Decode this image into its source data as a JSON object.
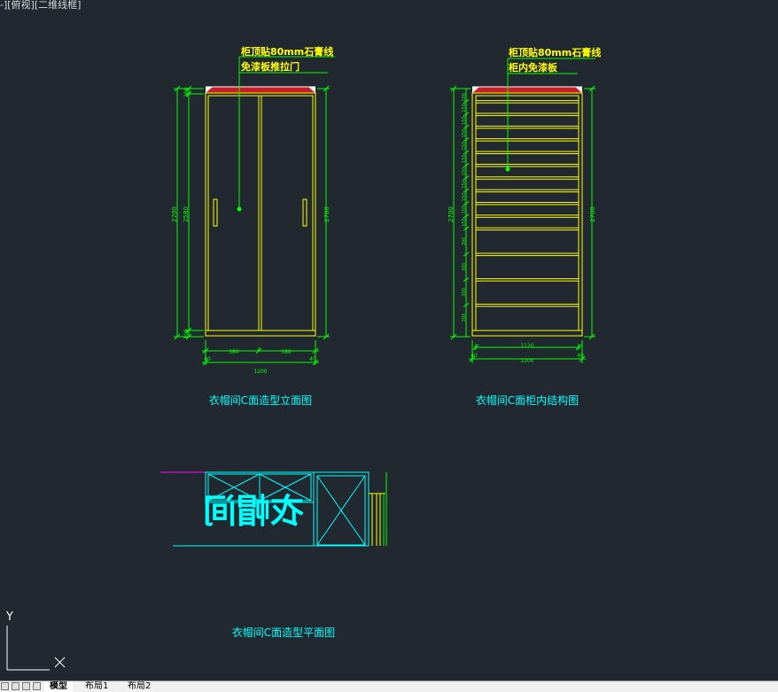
{
  "viewport": {
    "label": "-][俯视][二维线框]"
  },
  "views": {
    "elevation": {
      "title": "衣帽间C面造型立面图",
      "note_line1": "柜顶贴80mm石膏线",
      "note_line2": "免漆板推拉门",
      "dim_total_height_left": "2700",
      "dim_mid_height": "2580",
      "dim_top": "100",
      "dim_bottom": "100",
      "dim_total_height_right": "2700",
      "dim_door_left": "580",
      "dim_door_right": "580",
      "dim_edge_left": "40",
      "dim_edge_right": "40",
      "dim_total_width": "1200"
    },
    "structure": {
      "title": "衣帽间C面柜内结构图",
      "note_line1": "柜顶贴80mm石膏线",
      "note_line2": "柜内免漆板",
      "dim_total_height_left": "2700",
      "dim_total_height_right": "2700",
      "shelf_dims": [
        "100",
        "150",
        "150",
        "150",
        "150",
        "150",
        "150",
        "150",
        "150",
        "150",
        "150",
        "300",
        "300",
        "300",
        "300"
      ],
      "dim_inner_width": "1120",
      "dim_edge_left": "40",
      "dim_edge_right": "40",
      "dim_total_width": "1200"
    },
    "plan": {
      "title": "衣帽间C面造型平面图",
      "room_label": "衣帽间"
    }
  },
  "ucs": {
    "y_label": "Y",
    "x_label": "X"
  },
  "tabs": {
    "model": "模型",
    "layout1": "布局1",
    "layout2": "布局2"
  },
  "colors": {
    "background": "#212830",
    "yellow": "#ffff00",
    "green": "#00ff00",
    "cyan": "#00ffff",
    "red": "#ff0000",
    "magenta": "#ff00ff",
    "white": "#ffffff"
  }
}
